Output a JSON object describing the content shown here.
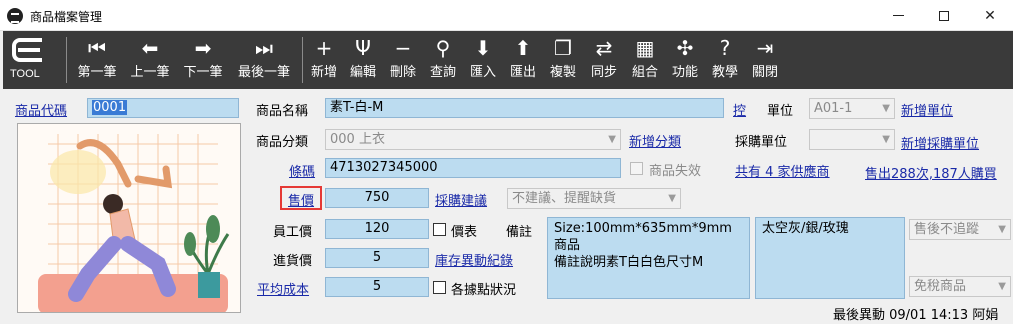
{
  "window": {
    "title": "商品檔案管理",
    "minimize": "—",
    "maximize": "□",
    "close": "✕"
  },
  "toolbar": {
    "logo_text": "TOOL",
    "buttons": [
      {
        "label": "第一筆",
        "icon": "first-icon",
        "glyph": "⏮"
      },
      {
        "label": "上一筆",
        "icon": "prev-icon",
        "glyph": "⬅"
      },
      {
        "label": "下一筆",
        "icon": "next-icon",
        "glyph": "➡"
      },
      {
        "label": "最後一筆",
        "icon": "last-icon",
        "glyph": "⏭"
      },
      {
        "label": "新增",
        "icon": "plus-icon",
        "glyph": "+"
      },
      {
        "label": "編輯",
        "icon": "edit-icon",
        "glyph": "Ψ"
      },
      {
        "label": "刪除",
        "icon": "minus-icon",
        "glyph": "−"
      },
      {
        "label": "查詢",
        "icon": "search-icon",
        "glyph": "⚲"
      },
      {
        "label": "匯入",
        "icon": "import-icon",
        "glyph": "⬇"
      },
      {
        "label": "匯出",
        "icon": "export-icon",
        "glyph": "⬆"
      },
      {
        "label": "複製",
        "icon": "copy-icon",
        "glyph": "❐"
      },
      {
        "label": "同步",
        "icon": "sync-icon",
        "glyph": "⇄"
      },
      {
        "label": "組合",
        "icon": "combine-icon",
        "glyph": "▦"
      },
      {
        "label": "功能",
        "icon": "function-icon",
        "glyph": "✣"
      },
      {
        "label": "教學",
        "icon": "help-icon",
        "glyph": "?"
      },
      {
        "label": "關閉",
        "icon": "exit-icon",
        "glyph": "⇥"
      }
    ]
  },
  "form": {
    "code_link": "商品代碼",
    "code_value": "0001",
    "name_label": "商品名稱",
    "name_value": "素T-白-M",
    "control_link": "控",
    "unit_label": "單位",
    "unit_value": "A01-1",
    "new_unit_link": "新增單位",
    "category_label": "商品分類",
    "category_value": "000 上衣",
    "new_category_link": "新增分類",
    "purchase_unit_label": "採購單位",
    "purchase_unit_value": "",
    "new_purchase_unit_link": "新增採購單位",
    "barcode_link": "條碼",
    "barcode_value": "4713027345000",
    "inactive_label": "商品失效",
    "suppliers_link": "共有 4 家供應商",
    "sales_link": "售出288次,187人購買",
    "price_link": "售價",
    "price_value": "750",
    "purchase_suggest_link": "採購建議",
    "purchase_suggest_value": "不建議、提醒缺貨",
    "staff_price_label": "員工價",
    "staff_price_value": "120",
    "price_list_label": "價表",
    "note_label": "備註",
    "note_lines": [
      "Size:100mm*635mm*9mm商品",
      "備註說明素T白白色尺寸M"
    ],
    "spec_text": "太空灰/銀/玫瑰",
    "aftersale_value": "售後不追蹤",
    "cost_in_label": "進貨價",
    "cost_in_value": "5",
    "stock_log_link": "庫存異動紀錄",
    "avg_cost_link": "平均成本",
    "avg_cost_value": "5",
    "branch_status_label": "各據點狀況",
    "tax_value": "免稅商品",
    "last_change": "最後異動 09/01 14:13 阿娟"
  }
}
